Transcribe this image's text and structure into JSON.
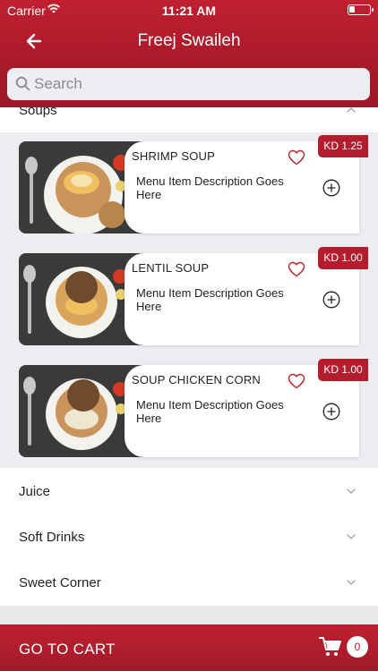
{
  "status_bar": {
    "carrier": "Carrier",
    "time": "11:21 AM"
  },
  "header": {
    "title": "Freej Swaileh"
  },
  "search": {
    "placeholder": "Search"
  },
  "expanded_category": {
    "label": "Soups"
  },
  "items": [
    {
      "name": "SHRIMP SOUP",
      "description": "Menu Item Description Goes Here",
      "price": "KD 1.25"
    },
    {
      "name": "LENTIL SOUP",
      "description": "Menu Item Description Goes Here",
      "price": "KD 1.00"
    },
    {
      "name": "SOUP CHICKEN CORN",
      "description": "Menu Item Description Goes Here",
      "price": "KD 1.00"
    }
  ],
  "categories": [
    {
      "label": "Juice"
    },
    {
      "label": "Soft Drinks"
    },
    {
      "label": "Sweet Corner"
    }
  ],
  "cart": {
    "label": "GO TO CART",
    "count": "0"
  },
  "colors": {
    "accent": "#b31d2e",
    "header": "#c0202f",
    "list_background": "#ececf1"
  },
  "icons": [
    "wifi-icon",
    "battery-icon",
    "back-arrow-icon",
    "search-icon",
    "heart-icon",
    "add-circle-icon",
    "chevron-down-icon",
    "chevron-up-icon",
    "cart-icon"
  ]
}
